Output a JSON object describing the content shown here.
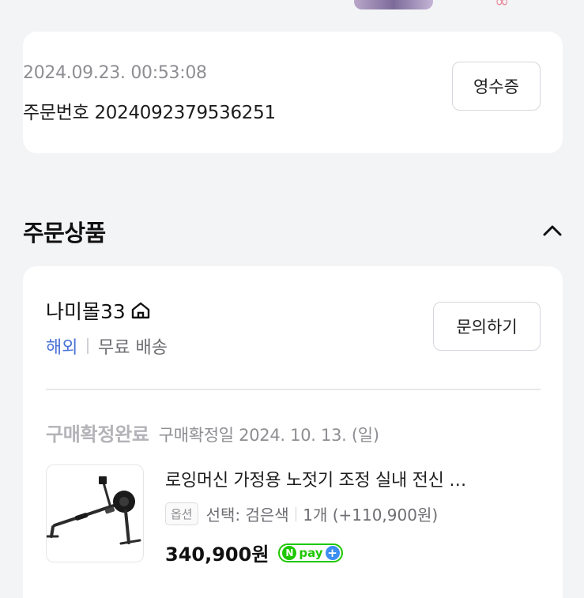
{
  "order": {
    "datetime": "2024.09.23. 00:53:08",
    "number_label": "주문번호 2024092379536251",
    "receipt_button": "영수증"
  },
  "section": {
    "title": "주문상품"
  },
  "store": {
    "name": "나미몰33",
    "overseas": "해외",
    "shipping": "무료 배송",
    "inquiry_button": "문의하기"
  },
  "item": {
    "status": "구매확정완료",
    "confirm_date": "구매확정일 2024. 10. 13. (일)",
    "title": "로잉머신 가정용 노젓기 조정 실내 전신 …",
    "option_tag": "옵션",
    "option_value": "선택: 검은색",
    "quantity": "1개 (+110,900원)",
    "price": "340,900원",
    "npay_label": "pay",
    "npay_n": "N",
    "npay_plus": "+"
  },
  "colors": {
    "accent_blue": "#4b74d6",
    "npay_green": "#1ec800",
    "npay_plus_blue": "#3c8ef0"
  }
}
